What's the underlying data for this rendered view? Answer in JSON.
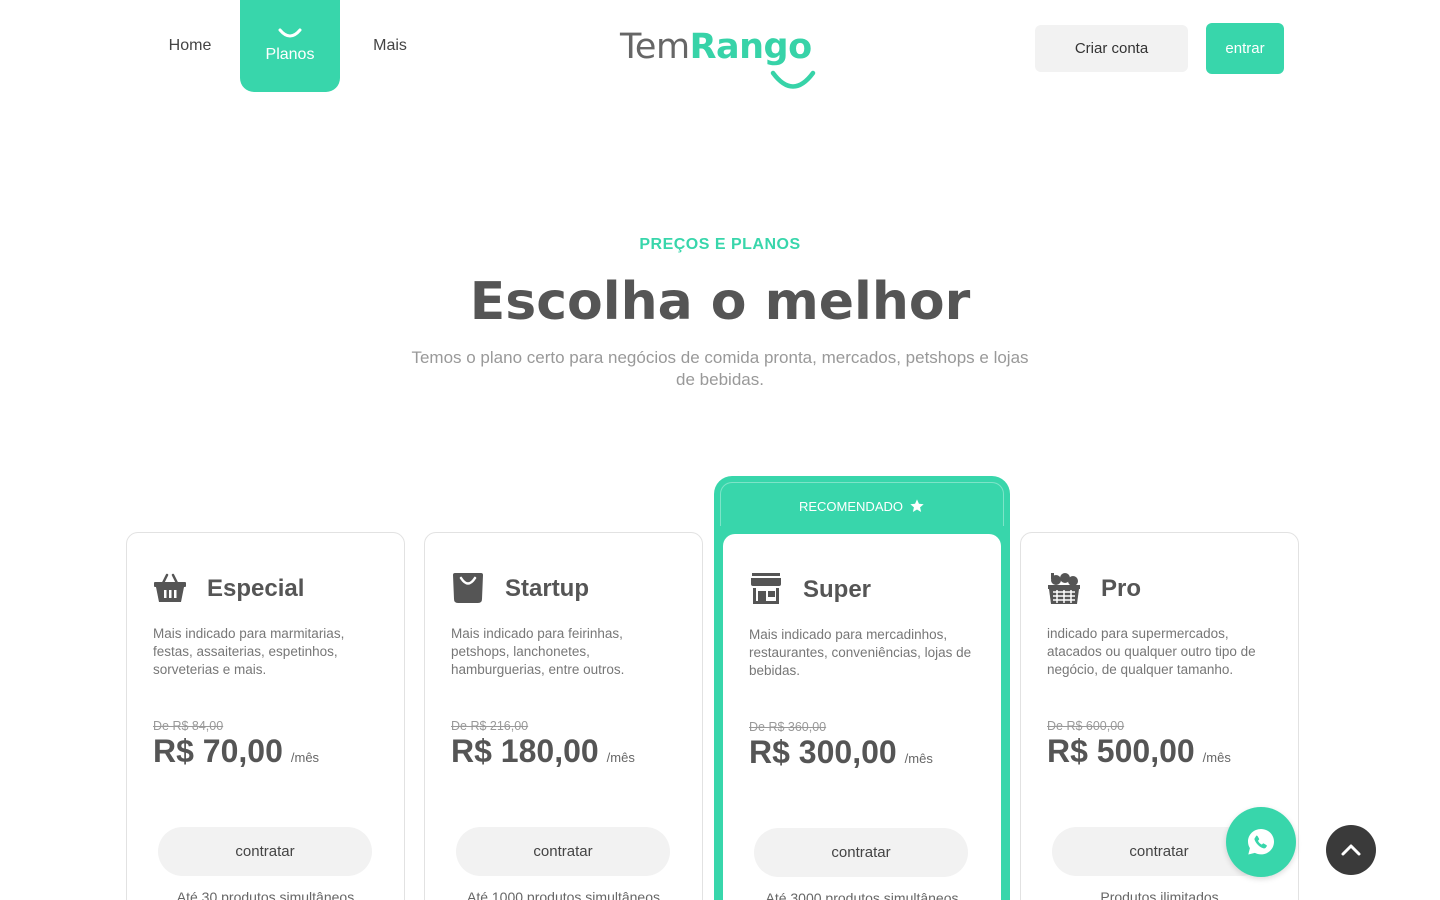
{
  "nav": {
    "home": "Home",
    "planos": "Planos",
    "mais": "Mais"
  },
  "logo": {
    "tem": "Tem",
    "rango": "Rango"
  },
  "header": {
    "criar_conta": "Criar conta",
    "entrar": "entrar"
  },
  "hero": {
    "eyebrow": "PREÇOS E PLANOS",
    "title": "Escolha o melhor",
    "subtitle": "Temos o plano certo para negócios de comida pronta, mercados, petshops e lojas de bebidas."
  },
  "recommended_label": "RECOMENDADO",
  "plans": [
    {
      "icon": "basket-icon",
      "name": "Especial",
      "description": "Mais indicado para marmitarias, festas, assaiterias, espetinhos, sorveterias e mais.",
      "old_price": "De R$ 84,00",
      "price": "R$ 70,00",
      "unit": "/mês",
      "cta": "contratar",
      "feature": "Até 30 produtos simultâneos"
    },
    {
      "icon": "shopping-bag-icon",
      "name": "Startup",
      "description": "Mais indicado para feirinhas, petshops, lanchonetes, hamburguerias, entre outros.",
      "old_price": "De R$ 216,00",
      "price": "R$ 180,00",
      "unit": "/mês",
      "cta": "contratar",
      "feature": "Até 1000 produtos simultâneos"
    },
    {
      "icon": "store-icon",
      "name": "Super",
      "description": "Mais indicado para mercadinhos, restaurantes, conveniências, lojas de bebidas.",
      "old_price": "De R$ 360,00",
      "price": "R$ 300,00",
      "unit": "/mês",
      "cta": "contratar",
      "feature": "Até 3000 produtos simultâneos"
    },
    {
      "icon": "grocery-basket-icon",
      "name": "Pro",
      "description": "indicado para supermercados, atacados ou qualquer outro tipo de negócio, de qualquer tamanho.",
      "old_price": "De R$ 600,00",
      "price": "R$ 500,00",
      "unit": "/mês",
      "cta": "contratar",
      "feature": "Produtos ilimitados"
    }
  ],
  "floating": {
    "whatsapp_icon": "whatsapp-icon",
    "top_icon": "chevron-up-icon"
  },
  "colors": {
    "accent": "#38d6ab",
    "text": "#555555",
    "muted": "#999999"
  }
}
